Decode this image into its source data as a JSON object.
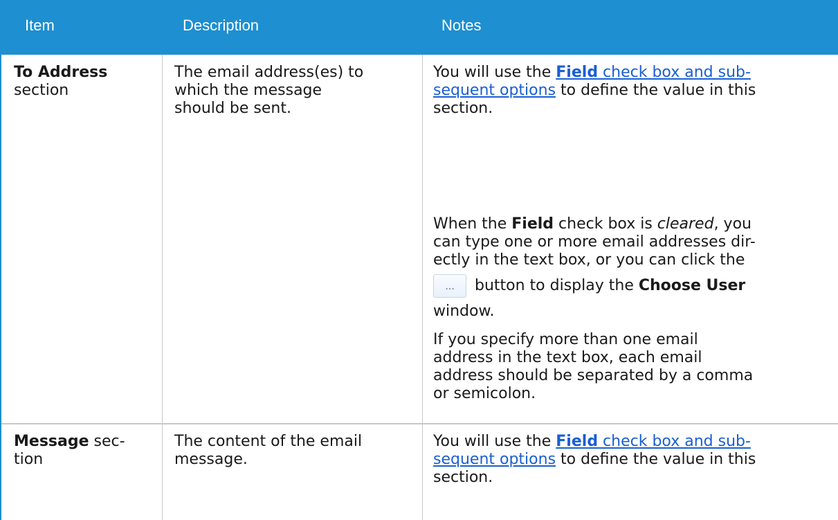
{
  "header": {
    "item": "Item",
    "description": "Description",
    "notes": "Notes"
  },
  "rows": [
    {
      "item_bold": "To Address",
      "item_rest": "section",
      "description": [
        "The email address(es) to",
        "which the message",
        "should be sent."
      ],
      "notes_intro": {
        "pre": "You will use the ",
        "link_bold": "Field",
        "link_rest_line1": " check box and sub-",
        "link_line2": "sequent options",
        "post_line2": " to define the value in this",
        "line3": "section."
      },
      "notes_cleared": {
        "l1_pre": "When the ",
        "l1_bold": "Field",
        "l1_mid": " check box is ",
        "l1_italic": "cleared",
        "l1_post": ", you",
        "l2": "can type one or more email addresses dir-",
        "l3": "ectly in the text box, or you can click the",
        "button_label": "...",
        "l4_mid": "button to display the ",
        "l4_bold": "Choose User",
        "l5": "window."
      },
      "notes_multi": [
        "If you specify more than one email",
        "address in the text box, each email",
        "address should be separated by a comma",
        "or semicolon."
      ]
    },
    {
      "item_bold": "Message",
      "item_rest_line1": " sec-",
      "item_rest_line2": "tion",
      "description": [
        "The content of the email",
        "message."
      ],
      "notes_intro": {
        "pre": "You will use the ",
        "link_bold": "Field",
        "link_rest_line1": " check box and sub-",
        "link_line2": "sequent options",
        "post_line2": " to define the value in this",
        "line3": "section."
      }
    }
  ]
}
